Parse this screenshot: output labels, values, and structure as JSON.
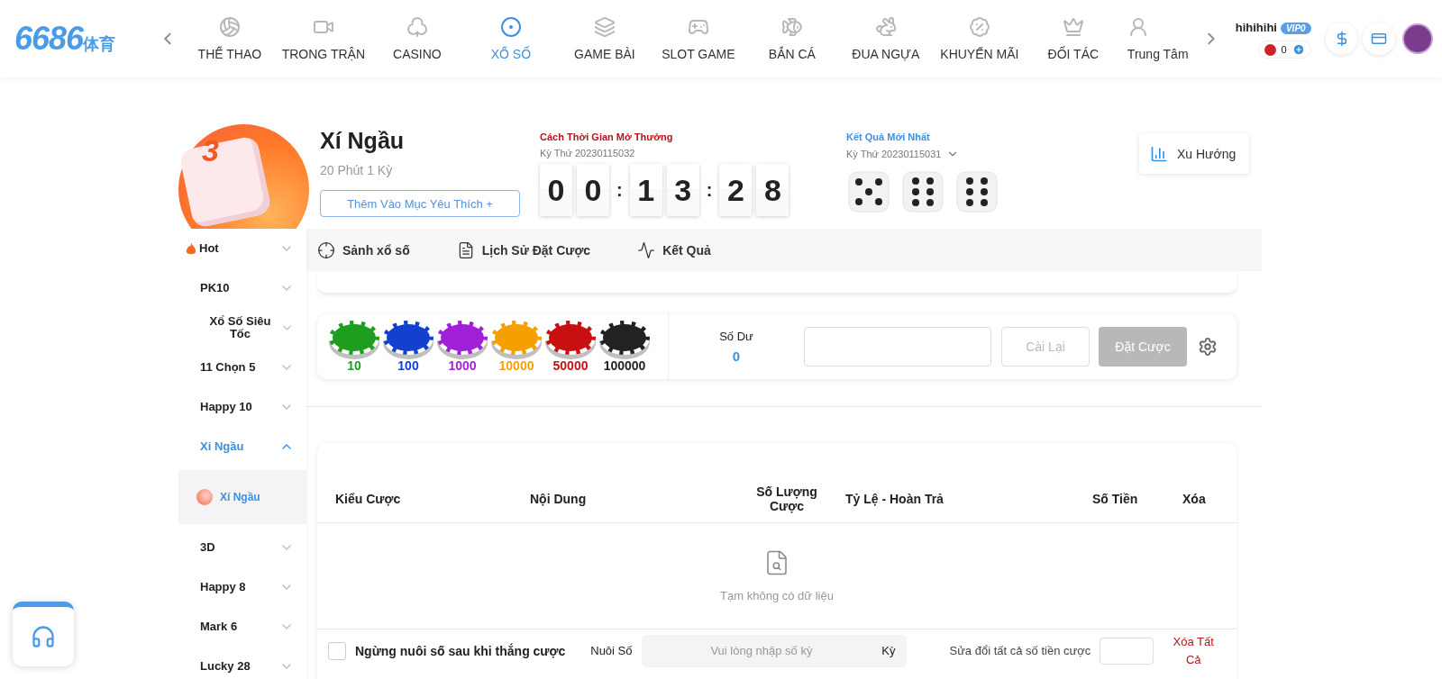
{
  "logo": {
    "number": "6686",
    "suffix": "体育"
  },
  "nav": [
    {
      "label": "THỂ THAO",
      "selected": false
    },
    {
      "label": "TRONG TRẬN",
      "selected": false
    },
    {
      "label": "CASINO",
      "selected": false
    },
    {
      "label": "XỔ SỐ",
      "selected": true
    },
    {
      "label": "GAME BÀI",
      "selected": false
    },
    {
      "label": "SLOT GAME",
      "selected": false
    },
    {
      "label": "BẮN CÁ",
      "selected": false
    },
    {
      "label": "ĐUA NGỰA",
      "selected": false
    },
    {
      "label": "KHUYẾN MÃI",
      "selected": false
    },
    {
      "label": "ĐỐI TÁC",
      "selected": false
    },
    {
      "label": "Trung Tâm",
      "selected": false
    }
  ],
  "user": {
    "name": "hihihihi",
    "vip": "VIP0",
    "balance": "0"
  },
  "game": {
    "badge_digit": "3",
    "title": "Xí Ngầu",
    "subtitle": "20 Phút 1 Kỳ",
    "favorite_button": "Thêm Vào Mục Yêu Thích +"
  },
  "countdown": {
    "label": "Cách Thời Gian Mở Thưởng",
    "period": "Kỳ Thứ 20230115032",
    "cells": [
      {
        "kind": "digit",
        "text": "0"
      },
      {
        "kind": "digit",
        "text": "0"
      },
      {
        "kind": "separator",
        "text": ":"
      },
      {
        "kind": "digit",
        "text": "1"
      },
      {
        "kind": "digit",
        "text": "3"
      },
      {
        "kind": "separator",
        "text": ":"
      },
      {
        "kind": "digit",
        "text": "2"
      },
      {
        "kind": "digit",
        "text": "8"
      }
    ]
  },
  "latest_result": {
    "label": "Kết Quả Mới Nhất",
    "period": "Kỳ Thứ 20230115031",
    "dice": [
      {
        "kind": "five"
      },
      {
        "kind": "six"
      },
      {
        "kind": "six"
      }
    ]
  },
  "trend_button": "Xu Hướng",
  "sidebar": [
    {
      "label": "Hot",
      "expanded": false,
      "selected": false
    },
    {
      "label": "PK10",
      "expanded": false,
      "selected": false
    },
    {
      "label": "Xổ Số Siêu Tốc",
      "expanded": false,
      "selected": false
    },
    {
      "label": "11 Chọn 5",
      "expanded": false,
      "selected": false
    },
    {
      "label": "Happy 10",
      "expanded": false,
      "selected": false
    },
    {
      "label": "Xi Ngầu",
      "expanded": true,
      "selected": true,
      "children": [
        {
          "label": "Xí Ngầu",
          "selected": true
        }
      ]
    },
    {
      "label": "3D",
      "expanded": false,
      "selected": false
    },
    {
      "label": "Happy 8",
      "expanded": false,
      "selected": false
    },
    {
      "label": "Mark 6",
      "expanded": false,
      "selected": false
    },
    {
      "label": "Lucky 28",
      "expanded": false,
      "selected": false
    }
  ],
  "tabs": [
    {
      "label": "Sảnh xổ số",
      "selected": false
    },
    {
      "label": "Lịch Sử Đặt Cược",
      "selected": false
    },
    {
      "label": "Kết Quả",
      "selected": false
    }
  ],
  "chips": [
    {
      "value": "10",
      "color": "#1e9e1e"
    },
    {
      "value": "100",
      "color": "#1440d0"
    },
    {
      "value": "1000",
      "color": "#a020d8"
    },
    {
      "value": "10000",
      "color": "#f5a000"
    },
    {
      "value": "50000",
      "color": "#c81010"
    },
    {
      "value": "100000",
      "color": "#222222"
    }
  ],
  "balance": {
    "label": "Số Dư",
    "value": "0"
  },
  "reset_button": "Cài Lại",
  "bet_button": {
    "label": "Đặt Cược",
    "disabled": true
  },
  "table": {
    "columns": [
      "Kiểu Cược",
      "Nội Dung",
      "Số Lượng Cược",
      "Tỷ Lệ - Hoàn Trả",
      "Số Tiền",
      "Xóa"
    ],
    "empty_text": "Tạm không có dữ liệu"
  },
  "footer": {
    "stop_checkbox": {
      "label": "Ngừng nuôi số sau khi thắng cược",
      "checked": false
    },
    "nurture_label": "Nuôi Số",
    "nurture_placeholder": "Vui lòng nhập số kỳ",
    "nurture_unit": "Kỳ",
    "modify_label": "Sửa đổi tất cả số tiền cược",
    "clear_all": "Xóa Tất Cả"
  }
}
